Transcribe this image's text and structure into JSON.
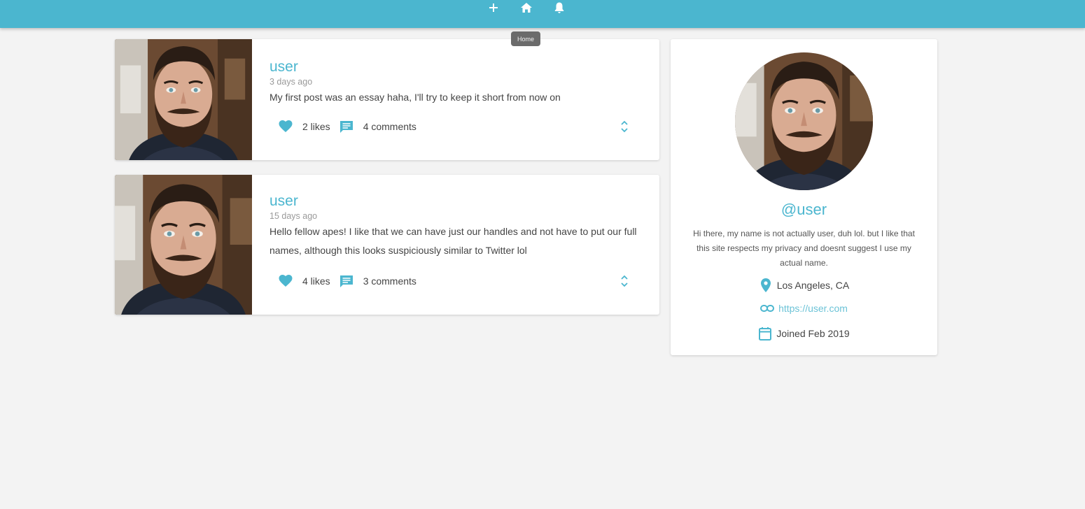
{
  "colors": {
    "accent": "#4bb6cf",
    "background": "#f3f3f3",
    "card": "#ffffff",
    "tooltip": "#6b6b6b"
  },
  "navbar": {
    "buttons": [
      {
        "name": "add-post-button",
        "icon": "plus-icon"
      },
      {
        "name": "home-button",
        "icon": "home-icon"
      },
      {
        "name": "notifications-button",
        "icon": "bell-icon"
      }
    ],
    "tooltip": "Home"
  },
  "posts": [
    {
      "username": "user",
      "time": "3 days ago",
      "body": "My first post was an essay haha, I'll try to keep it short from now on",
      "likes": "2 likes",
      "comments": "4 comments"
    },
    {
      "username": "user",
      "time": "15 days ago",
      "body": "Hello fellow apes! I like that we can have just our handles and not have to put our full names, although this looks suspiciously similar to Twitter lol",
      "likes": "4 likes",
      "comments": "3 comments"
    }
  ],
  "profile": {
    "handle": "@user",
    "bio": "Hi there, my name is not actually user, duh lol. but I like that this site respects my privacy and doesnt suggest I use my actual name.",
    "location": "Los Angeles, CA",
    "website": "https://user.com",
    "joined": "Joined Feb 2019"
  },
  "icons": {
    "like": "heart-icon",
    "comment": "chat-icon",
    "expand": "unfold-icon",
    "location": "map-pin-icon",
    "website": "link-icon",
    "joined": "calendar-icon"
  }
}
